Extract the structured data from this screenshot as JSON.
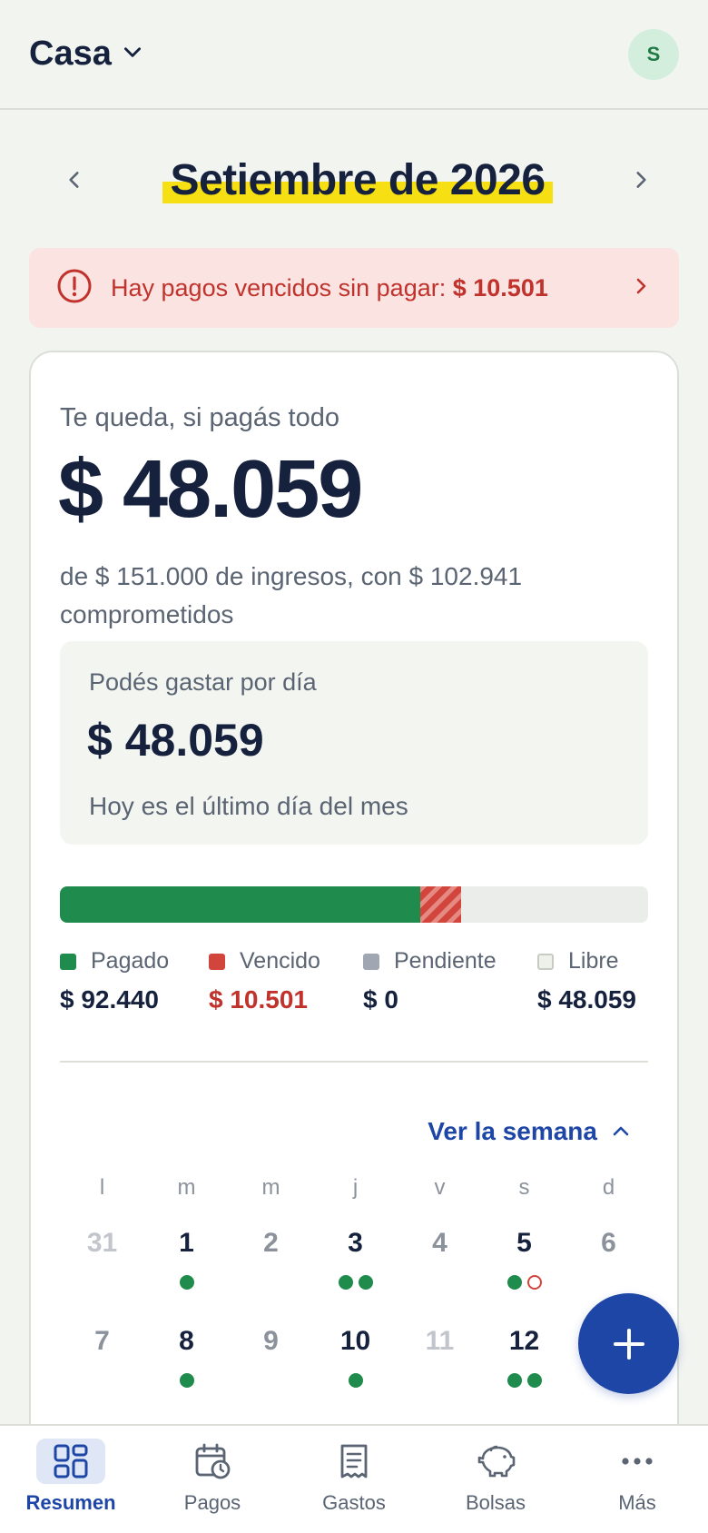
{
  "header": {
    "home_title": "Casa",
    "avatar_initial": "S"
  },
  "month_nav": {
    "title": "Setiembre de 2026"
  },
  "alert": {
    "text": "Hay pagos vencidos sin pagar:",
    "amount": "$ 10.501"
  },
  "summary": {
    "label": "Te queda, si pagás todo",
    "amount": "$ 48.059",
    "subtitle": "de $ 151.000 de ingresos, con $ 102.941 comprometidos",
    "daily": {
      "label": "Podés gastar por día",
      "amount": "$ 48.059",
      "note": "Hoy es el último día del mes"
    },
    "bar": {
      "paid_fraction": 0.612,
      "overdue_fraction": 0.07,
      "pending_fraction": 0
    },
    "legend": [
      {
        "label": "Pagado",
        "value": "$ 92.440",
        "color": "#1f8b4c"
      },
      {
        "label": "Vencido",
        "value": "$ 10.501",
        "color": "#d2453d"
      },
      {
        "label": "Pendiente",
        "value": "$ 0",
        "color": "#a0a7b2"
      },
      {
        "label": "Libre",
        "value": "$ 48.059",
        "color": "#ebedea"
      }
    ]
  },
  "calendar": {
    "toggle_label": "Ver la semana",
    "weekdays": [
      "l",
      "m",
      "m",
      "j",
      "v",
      "s",
      "d"
    ],
    "rows": [
      [
        "31",
        "1",
        "2",
        "3",
        "4",
        "5",
        "6"
      ],
      [
        "7",
        "8",
        "9",
        "10",
        "11",
        "12",
        ""
      ]
    ]
  },
  "tabs": [
    {
      "label": "Resumen",
      "icon": "grid-icon",
      "active": true
    },
    {
      "label": "Pagos",
      "icon": "calendar-clock-icon",
      "active": false
    },
    {
      "label": "Gastos",
      "icon": "receipt-icon",
      "active": false
    },
    {
      "label": "Bolsas",
      "icon": "piggy-bank-icon",
      "active": false
    },
    {
      "label": "Más",
      "icon": "more-icon",
      "active": false
    }
  ],
  "colors": {
    "brand_blue": "#1e46a6",
    "paid_green": "#1f8b4c",
    "overdue_red": "#d2453d",
    "highlight_yellow": "#f6df12"
  }
}
